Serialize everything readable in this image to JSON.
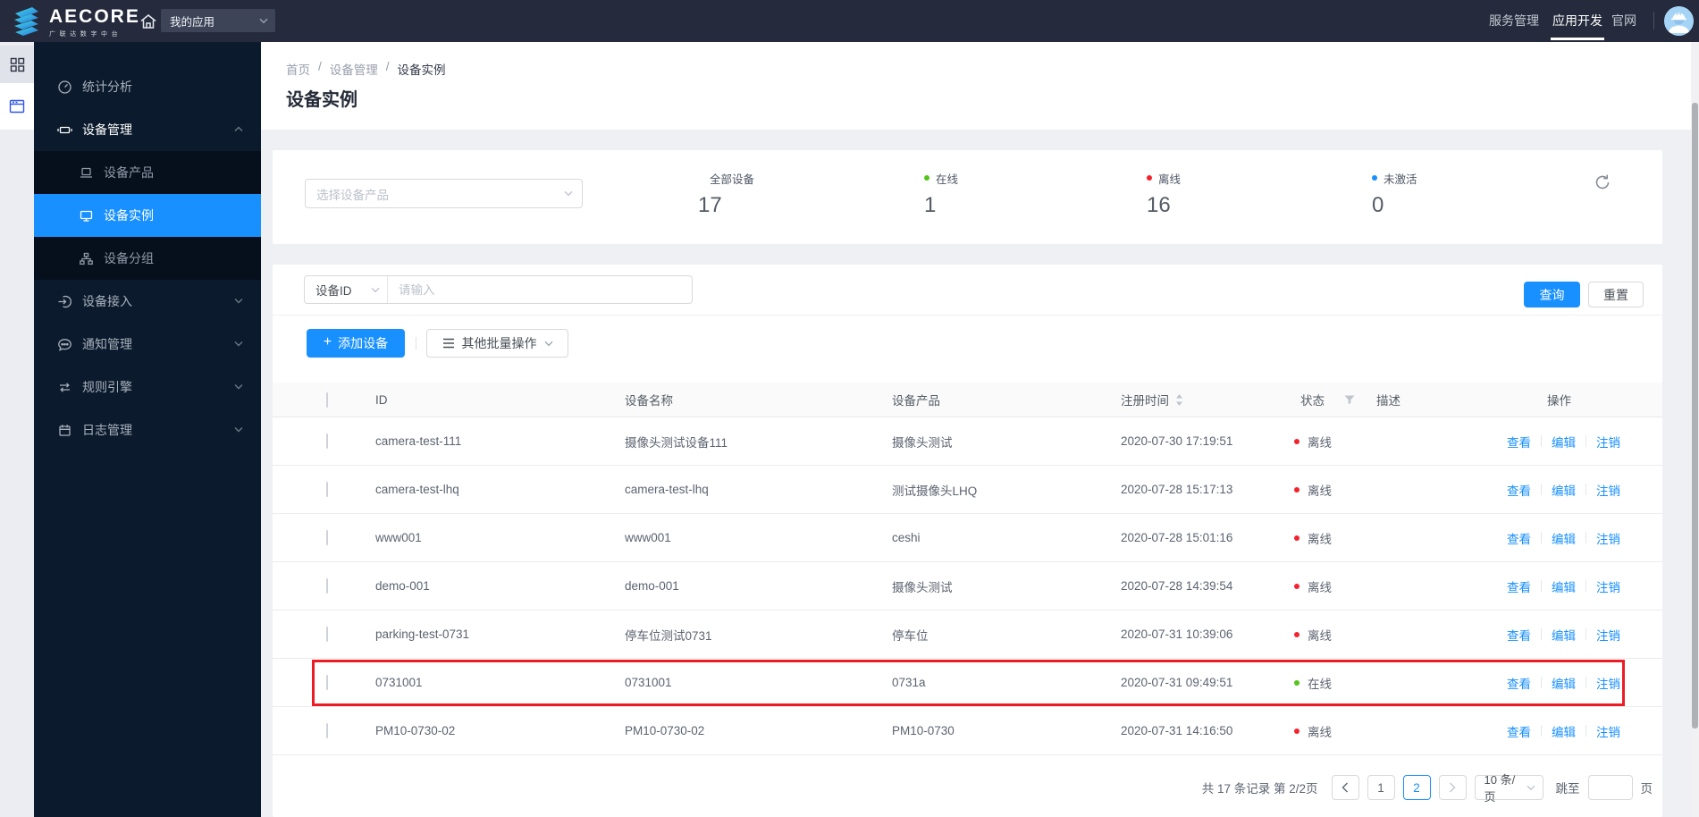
{
  "topbar": {
    "logo_text": "AECORE",
    "logo_subtext": "广联达数字中台",
    "app_select": "我的应用",
    "nav": [
      {
        "label": "服务管理"
      },
      {
        "label": "应用开发"
      },
      {
        "label": "官网"
      }
    ]
  },
  "sidebar": {
    "items": [
      {
        "label": "统计分析"
      },
      {
        "label": "设备管理"
      },
      {
        "label": "设备产品"
      },
      {
        "label": "设备实例"
      },
      {
        "label": "设备分组"
      },
      {
        "label": "设备接入"
      },
      {
        "label": "通知管理"
      },
      {
        "label": "规则引擎"
      },
      {
        "label": "日志管理"
      }
    ]
  },
  "breadcrumb": {
    "items": [
      "首页",
      "设备管理",
      "设备实例"
    ],
    "separator": "/"
  },
  "page_title": "设备实例",
  "stats": {
    "product_select_placeholder": "选择设备产品",
    "items": [
      {
        "label": "全部设备",
        "value": "17",
        "dot": ""
      },
      {
        "label": "在线",
        "value": "1",
        "dot": "#52c41a"
      },
      {
        "label": "离线",
        "value": "16",
        "dot": "#f5222d"
      },
      {
        "label": "未激活",
        "value": "0",
        "dot": "#1890ff"
      }
    ]
  },
  "filter": {
    "field_label": "设备ID",
    "input_placeholder": "请输入",
    "search_label": "查询",
    "reset_label": "重置"
  },
  "toolbar": {
    "add_label": "添加设备",
    "batch_label": "其他批量操作"
  },
  "table": {
    "headers": [
      "ID",
      "设备名称",
      "设备产品",
      "注册时间",
      "状态",
      "描述",
      "操作"
    ],
    "actions": [
      "查看",
      "编辑",
      "注销"
    ],
    "status_colors": {
      "在线": "#52c41a",
      "离线": "#f5222d"
    },
    "rows": [
      {
        "id": "camera-test-111",
        "name": "摄像头测试设备111",
        "product": "摄像头测试",
        "time": "2020-07-30 17:19:51",
        "status": "离线",
        "desc": ""
      },
      {
        "id": "camera-test-lhq",
        "name": "camera-test-lhq",
        "product": "测试摄像头LHQ",
        "time": "2020-07-28 15:17:13",
        "status": "离线",
        "desc": ""
      },
      {
        "id": "www001",
        "name": "www001",
        "product": "ceshi",
        "time": "2020-07-28 15:01:16",
        "status": "离线",
        "desc": ""
      },
      {
        "id": "demo-001",
        "name": "demo-001",
        "product": "摄像头测试",
        "time": "2020-07-28 14:39:54",
        "status": "离线",
        "desc": ""
      },
      {
        "id": "parking-test-0731",
        "name": "停车位测试0731",
        "product": "停车位",
        "time": "2020-07-31 10:39:06",
        "status": "离线",
        "desc": ""
      },
      {
        "id": "0731001",
        "name": "0731001",
        "product": "0731a",
        "time": "2020-07-31 09:49:51",
        "status": "在线",
        "desc": "",
        "highlighted": true
      },
      {
        "id": "PM10-0730-02",
        "name": "PM10-0730-02",
        "product": "PM10-0730",
        "time": "2020-07-31 14:16:50",
        "status": "离线",
        "desc": ""
      }
    ]
  },
  "pagination": {
    "total_text": "共 17 条记录 第 2/2页",
    "pages": [
      "1",
      "2"
    ],
    "current_page": "2",
    "page_size": "10 条/页",
    "jump_label": "跳至",
    "jump_suffix": "页"
  }
}
